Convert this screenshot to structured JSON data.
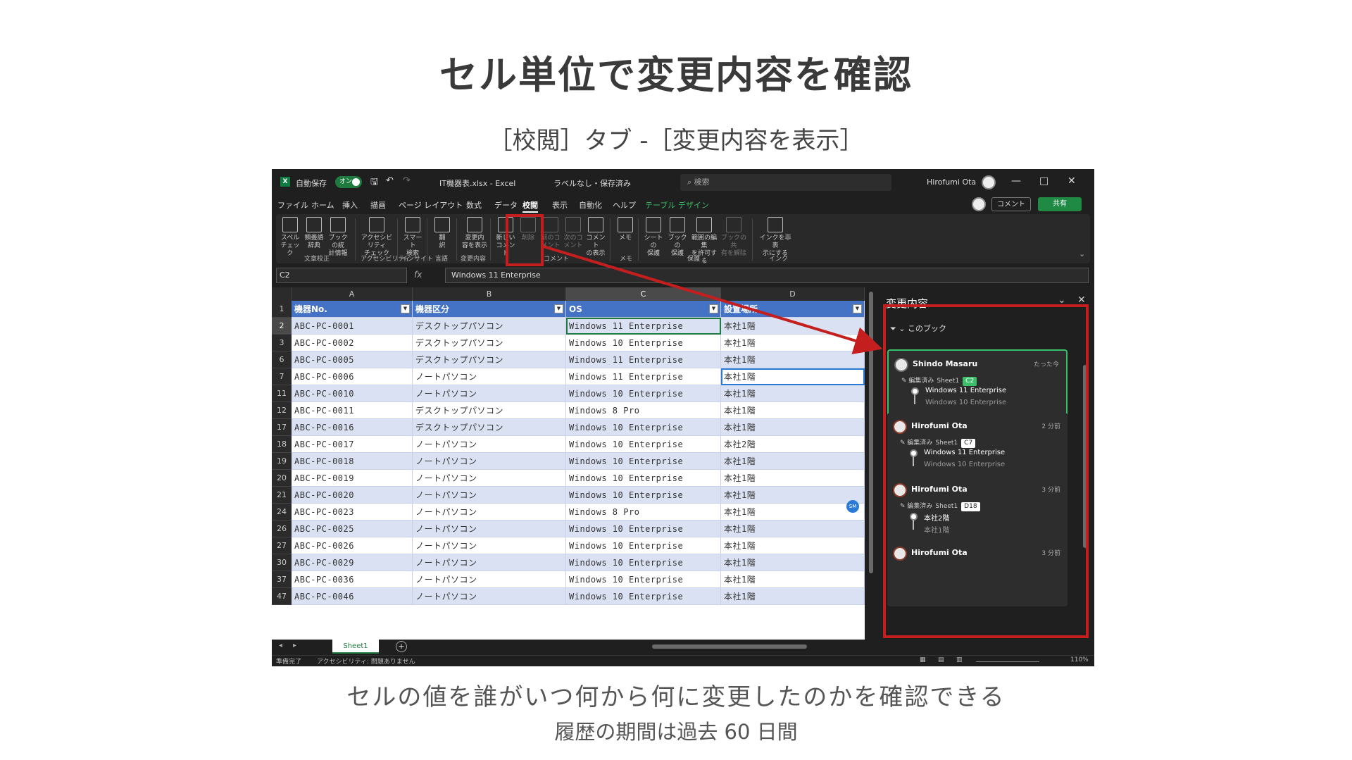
{
  "slide": {
    "title": "セル単位で変更内容を確認",
    "subtitle": "［校閲］タブ -［変更内容を表示］",
    "caption_line1": "セルの値を誰がいつ何から何に変更したのかを確認できる",
    "caption_line2": "履歴の期間は過去 60 日間"
  },
  "titlebar": {
    "app_icon": "X",
    "autosave_label": "自動保存",
    "autosave_state": "オン",
    "filename": "IT機器表.xlsx - Excel",
    "sensitivity": "ラベルなし・保存済み",
    "search_placeholder": "検索",
    "user_name": "Hirofumi Ota",
    "minimize": "—",
    "maximize": "□",
    "close": "✕"
  },
  "menu": {
    "tabs": [
      "ファイル",
      "ホーム",
      "挿入",
      "描画",
      "ページ レイアウト",
      "数式",
      "データ",
      "校閲",
      "表示",
      "自動化",
      "ヘルプ",
      "テーブル デザイン"
    ],
    "active_tab": "校閲",
    "comment_button": "コメント",
    "share_button": "共有"
  },
  "ribbon": {
    "buttons": [
      {
        "label": "スペル\nチェック",
        "icon": "spellcheck-icon"
      },
      {
        "label": "類義語\n辞典",
        "icon": "thesaurus-icon"
      },
      {
        "label": "ブックの統\n計情報",
        "icon": "workbook-stats-icon"
      },
      {
        "label": "アクセシビリティ\nチェック",
        "icon": "accessibility-icon"
      },
      {
        "label": "スマート\n検索",
        "icon": "smart-lookup-icon"
      },
      {
        "label": "翻\n訳",
        "icon": "translate-icon"
      },
      {
        "label": "変更内\n容を表示",
        "icon": "show-changes-icon"
      },
      {
        "label": "新しい\nコメント",
        "icon": "new-comment-icon"
      },
      {
        "label": "削除",
        "icon": "delete-comment-icon"
      },
      {
        "label": "前のコ\nメント",
        "icon": "prev-comment-icon"
      },
      {
        "label": "次のコ\nメント",
        "icon": "next-comment-icon"
      },
      {
        "label": "コメント\nの表示",
        "icon": "show-comments-icon"
      },
      {
        "label": "メモ",
        "icon": "notes-icon"
      },
      {
        "label": "シートの\n保護",
        "icon": "protect-sheet-icon"
      },
      {
        "label": "ブックの\n保護",
        "icon": "protect-workbook-icon"
      },
      {
        "label": "範囲の編集\nを許可する",
        "icon": "allow-edit-ranges-icon"
      },
      {
        "label": "ブックの共\n有を解除",
        "icon": "unshare-workbook-icon"
      },
      {
        "label": "インクを非表\n示にする",
        "icon": "hide-ink-icon"
      }
    ],
    "groups": [
      "文章校正",
      "アクセシビリティ",
      "インサイト",
      "言語",
      "変更内容",
      "コメント",
      "メモ",
      "保護",
      "インク"
    ]
  },
  "formula_bar": {
    "name_box": "C2",
    "fx": "fx",
    "value": "Windows 11 Enterprise"
  },
  "sheet": {
    "columns": [
      "A",
      "B",
      "C",
      "D"
    ],
    "selected_column": "C",
    "header_row": {
      "num": "1",
      "cells": [
        "機器No.",
        "機器区分",
        "OS",
        "設置場所"
      ]
    },
    "rows": [
      {
        "num": "2",
        "cells": [
          "ABC-PC-0001",
          "デスクトップパソコン",
          "Windows 11 Enterprise",
          "本社1階"
        ]
      },
      {
        "num": "3",
        "cells": [
          "ABC-PC-0002",
          "デスクトップパソコン",
          "Windows 10 Enterprise",
          "本社1階"
        ]
      },
      {
        "num": "6",
        "cells": [
          "ABC-PC-0005",
          "デスクトップパソコン",
          "Windows 11 Enterprise",
          "本社1階"
        ]
      },
      {
        "num": "7",
        "cells": [
          "ABC-PC-0006",
          "ノートパソコン",
          "Windows 11 Enterprise",
          "本社1階"
        ]
      },
      {
        "num": "11",
        "cells": [
          "ABC-PC-0010",
          "ノートパソコン",
          "Windows 10 Enterprise",
          "本社1階"
        ]
      },
      {
        "num": "12",
        "cells": [
          "ABC-PC-0011",
          "デスクトップパソコン",
          "Windows 8 Pro",
          "本社1階"
        ]
      },
      {
        "num": "17",
        "cells": [
          "ABC-PC-0016",
          "デスクトップパソコン",
          "Windows 10 Enterprise",
          "本社1階"
        ]
      },
      {
        "num": "18",
        "cells": [
          "ABC-PC-0017",
          "ノートパソコン",
          "Windows 10 Enterprise",
          "本社2階"
        ]
      },
      {
        "num": "19",
        "cells": [
          "ABC-PC-0018",
          "ノートパソコン",
          "Windows 10 Enterprise",
          "本社1階"
        ]
      },
      {
        "num": "20",
        "cells": [
          "ABC-PC-0019",
          "ノートパソコン",
          "Windows 10 Enterprise",
          "本社1階"
        ]
      },
      {
        "num": "21",
        "cells": [
          "ABC-PC-0020",
          "ノートパソコン",
          "Windows 10 Enterprise",
          "本社1階"
        ]
      },
      {
        "num": "24",
        "cells": [
          "ABC-PC-0023",
          "ノートパソコン",
          "Windows 8 Pro",
          "本社1階"
        ]
      },
      {
        "num": "26",
        "cells": [
          "ABC-PC-0025",
          "ノートパソコン",
          "Windows 10 Enterprise",
          "本社1階"
        ]
      },
      {
        "num": "27",
        "cells": [
          "ABC-PC-0026",
          "ノートパソコン",
          "Windows 10 Enterprise",
          "本社1階"
        ]
      },
      {
        "num": "30",
        "cells": [
          "ABC-PC-0029",
          "ノートパソコン",
          "Windows 10 Enterprise",
          "本社1階"
        ]
      },
      {
        "num": "37",
        "cells": [
          "ABC-PC-0036",
          "ノートパソコン",
          "Windows 10 Enterprise",
          "本社1階"
        ]
      },
      {
        "num": "47",
        "cells": [
          "ABC-PC-0046",
          "ノートパソコン",
          "Windows 10 Enterprise",
          "本社1階"
        ]
      }
    ],
    "tab_name": "Sheet1",
    "editor_badge": "SM"
  },
  "status_bar": {
    "ready": "準備完了",
    "accessibility": "アクセシビリティ: 問題ありません",
    "zoom": "110%"
  },
  "changes_pane": {
    "title": "変更内容",
    "filter_label": "このブック",
    "cards": [
      {
        "user": "Shindo Masaru",
        "time": "たった今",
        "action": "編集済み",
        "sheet": "Sheet1",
        "cell": "C2",
        "new_value": "Windows 11 Enterprise",
        "old_value": "Windows 10 Enterprise",
        "selected": true
      },
      {
        "user": "Hirofumi Ota",
        "time": "2 分前",
        "action": "編集済み",
        "sheet": "Sheet1",
        "cell": "C7",
        "new_value": "Windows 11 Enterprise",
        "old_value": "Windows 10 Enterprise",
        "selected": false
      },
      {
        "user": "Hirofumi Ota",
        "time": "3 分前",
        "action": "編集済み",
        "sheet": "Sheet1",
        "cell": "D18",
        "new_value": "本社2階",
        "old_value": "本社1階",
        "selected": false
      },
      {
        "user": "Hirofumi Ota",
        "time": "3 分前",
        "action": "",
        "sheet": "",
        "cell": "",
        "new_value": "",
        "old_value": "",
        "selected": false
      }
    ]
  },
  "colors": {
    "highlight_red": "#c41e1e",
    "table_header": "#4472c4",
    "band": "#d9e1f2",
    "excel_green": "#1e7a3e",
    "card_green": "#3cbf6a"
  }
}
